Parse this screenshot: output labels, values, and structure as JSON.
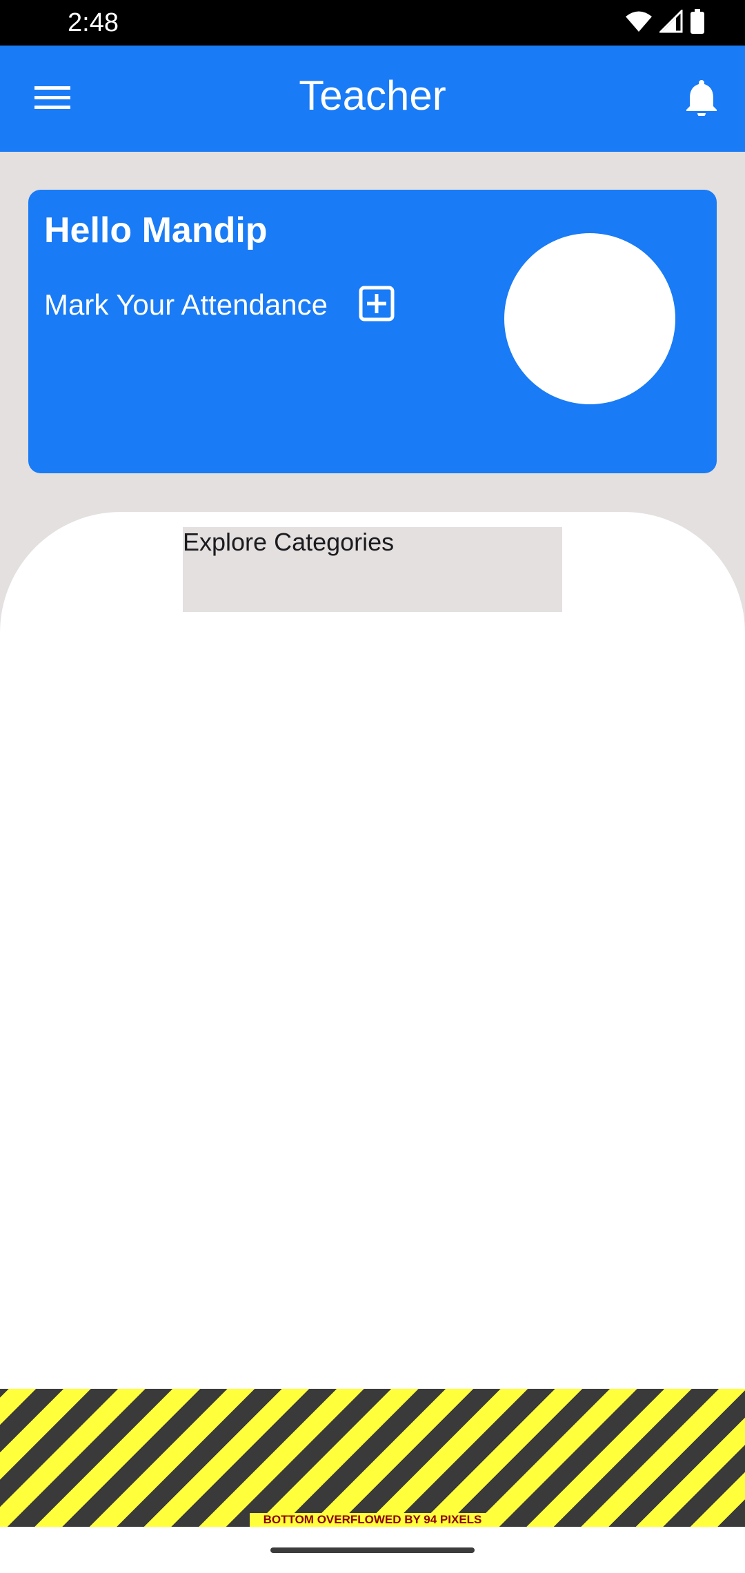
{
  "status_bar": {
    "time": "2:48",
    "icons": [
      "wifi-icon",
      "signal-icon",
      "battery-icon"
    ]
  },
  "app_bar": {
    "title": "Teacher",
    "menu_icon": "menu-icon",
    "notification_icon": "bell-icon",
    "color": "#197bf6"
  },
  "greeting_card": {
    "title": "Hello Mandip",
    "attendance_label": "Mark Your Attendance",
    "attendance_icon": "add-box-icon"
  },
  "explore": {
    "title": "Explore Categories"
  },
  "debug_overflow": {
    "message": "BOTTOM OVERFLOWED BY 94 PIXELS"
  }
}
